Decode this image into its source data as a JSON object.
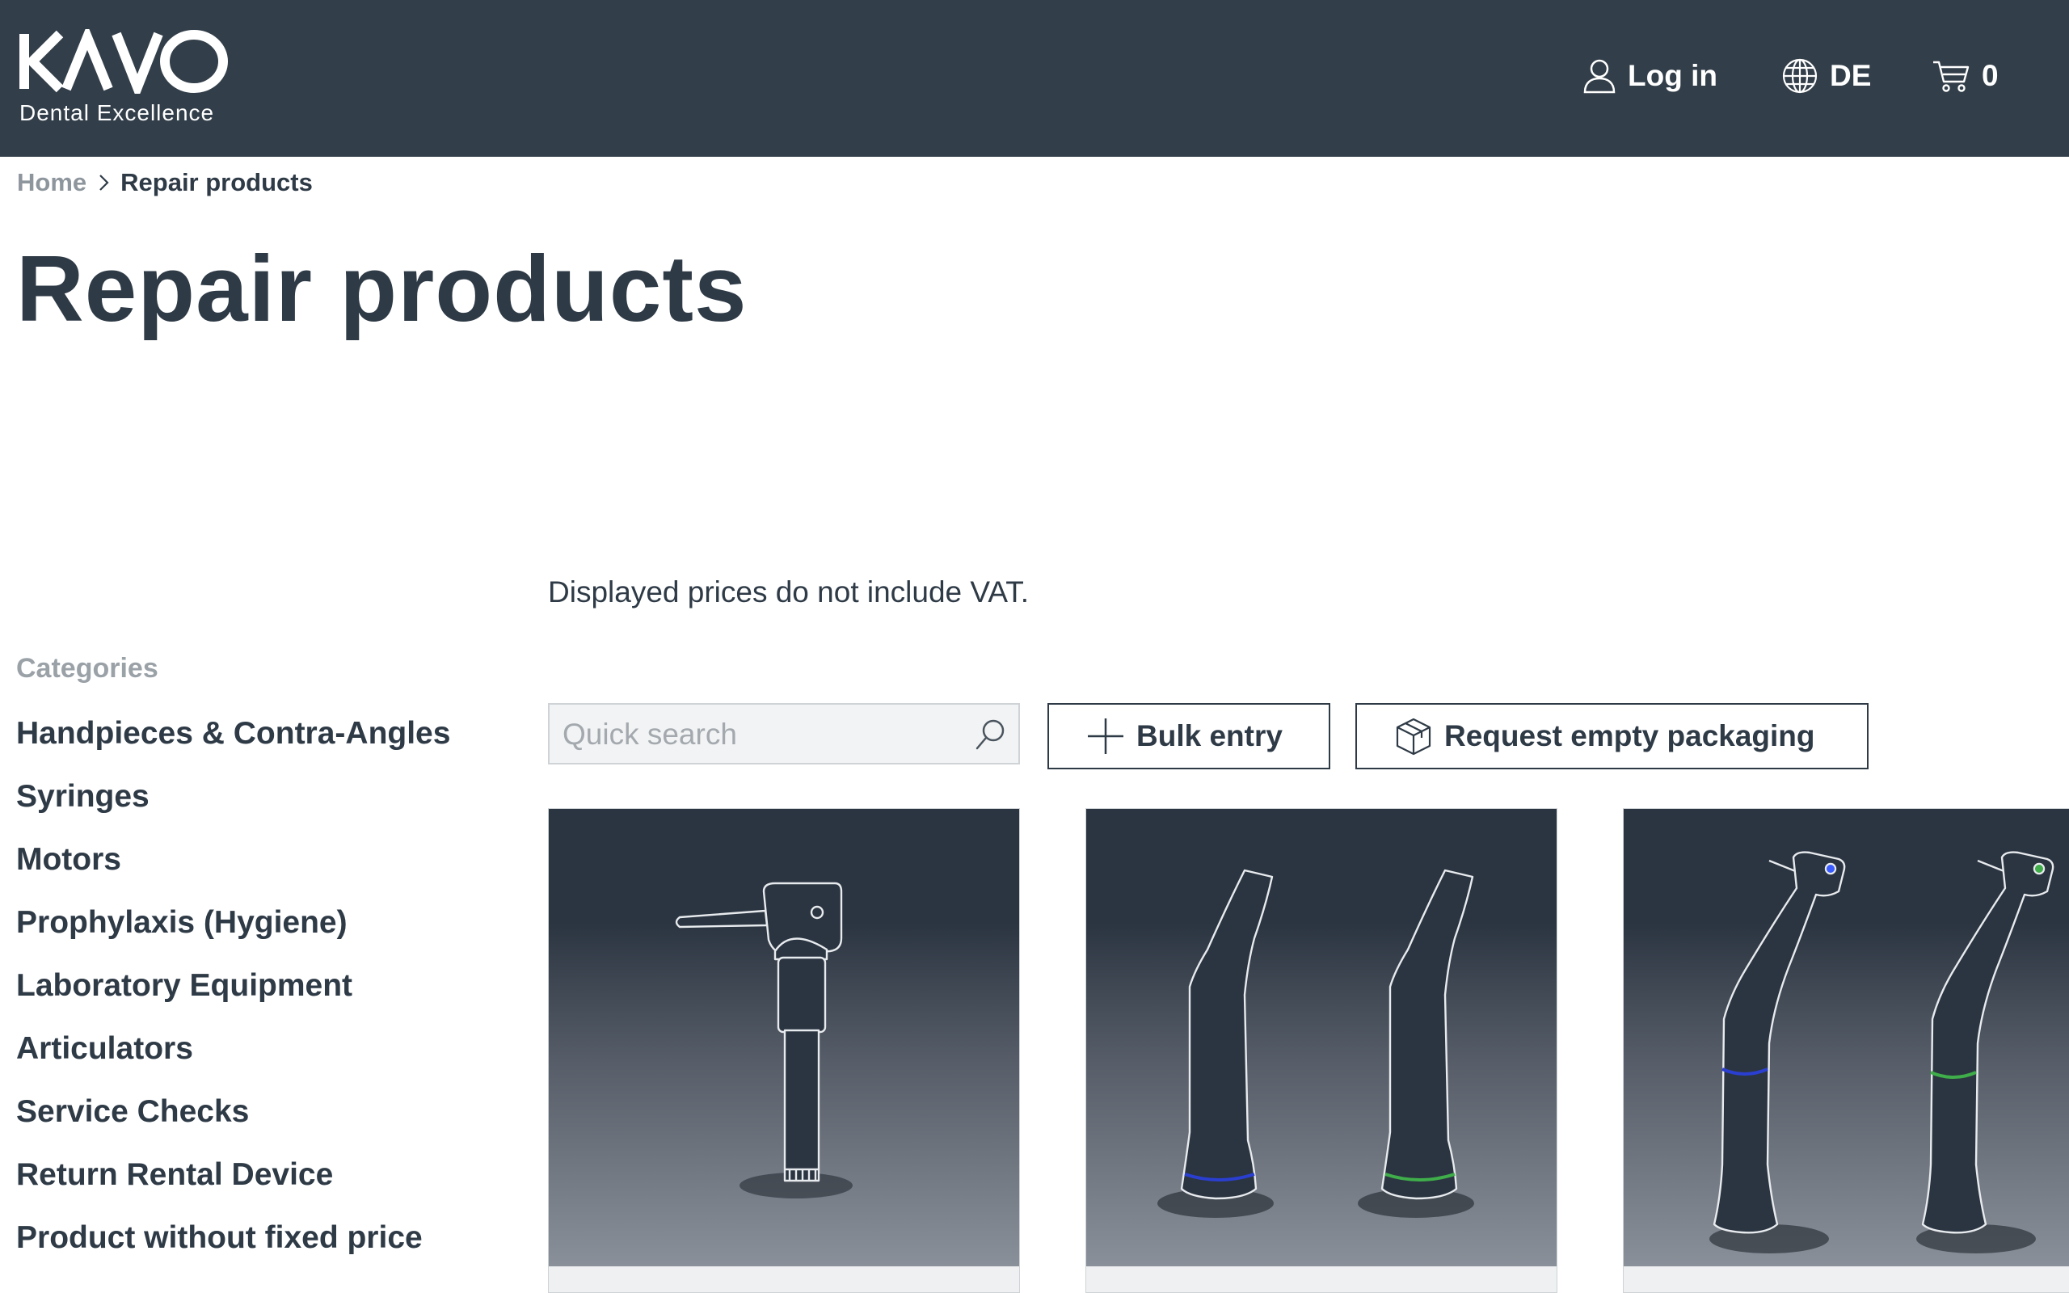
{
  "header": {
    "logo_text": "KAVO",
    "logo_tagline": "Dental Excellence",
    "login_label": "Log in",
    "language_label": "DE",
    "cart_count": "0"
  },
  "breadcrumb": {
    "home": "Home",
    "current": "Repair products"
  },
  "page_title": "Repair products",
  "vat_note": "Displayed prices do not include VAT.",
  "categories": {
    "heading": "Categories",
    "items": [
      "Handpieces & Contra-Angles",
      "Syringes",
      "Motors",
      "Prophylaxis (Hygiene)",
      "Laboratory Equipment",
      "Articulators",
      "Service Checks",
      "Return Rental Device",
      "Product without fixed price"
    ]
  },
  "toolbar": {
    "search_placeholder": "Quick search",
    "bulk_entry_label": "Bulk entry",
    "empty_packaging_label": "Request empty packaging"
  },
  "products": [
    {
      "image": "prophy-handpiece-outline"
    },
    {
      "image": "straight-handpieces-blue-green-rings"
    },
    {
      "image": "contra-angles-blue-green-rings"
    }
  ],
  "colors": {
    "header_bg": "#323e49",
    "text_dark": "#2e3a46",
    "ring_blue": "#2a3fd1",
    "ring_green": "#3fae4a"
  }
}
